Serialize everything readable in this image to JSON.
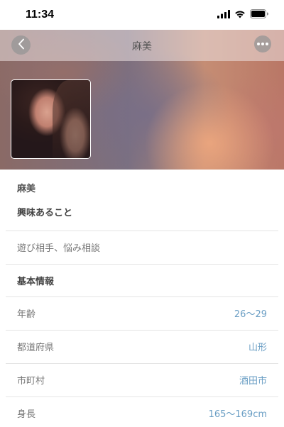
{
  "status_bar": {
    "time": "11:34",
    "icons": [
      "signal-icon",
      "wifi-icon",
      "battery-icon"
    ]
  },
  "navbar": {
    "title": "麻美",
    "back_icon": "chevron-left-icon",
    "more_icon": "more-dots-icon"
  },
  "profile": {
    "name": "麻美"
  },
  "interests": {
    "heading": "興味あること",
    "value": "遊び相手、悩み相談"
  },
  "basic_info": {
    "heading": "基本情報",
    "rows": [
      {
        "label": "年齢",
        "value": "26～29"
      },
      {
        "label": "都道府県",
        "value": "山形"
      },
      {
        "label": "市町村",
        "value": "酒田市"
      },
      {
        "label": "身長",
        "value": "165～169cm"
      }
    ]
  },
  "colors": {
    "value_text": "#6a9ec4",
    "divider": "#e4e4e4"
  }
}
